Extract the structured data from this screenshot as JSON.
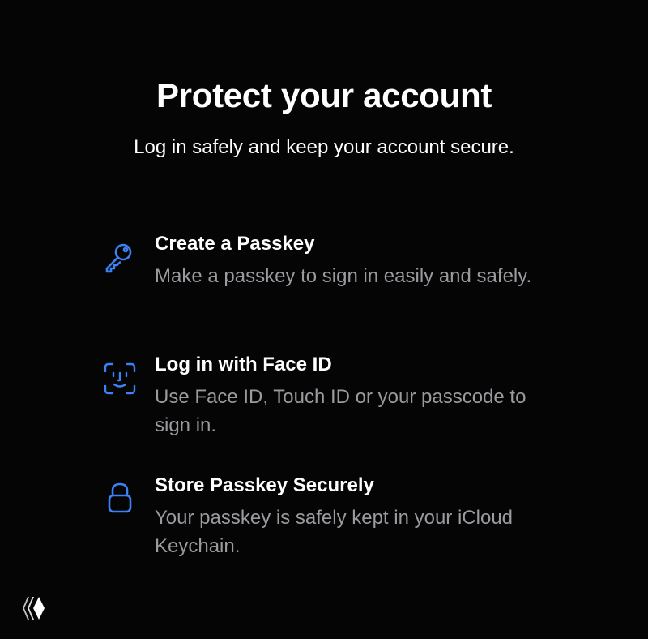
{
  "page": {
    "title": "Protect your account",
    "subtitle": "Log in safely and keep your account secure."
  },
  "features": [
    {
      "icon": "key-icon",
      "title": "Create a Passkey",
      "description": "Make a passkey to sign in easily and safely."
    },
    {
      "icon": "face-id-icon",
      "title": "Log in with Face ID",
      "description": "Use Face ID, Touch ID or your passcode to sign in."
    },
    {
      "icon": "lock-icon",
      "title": "Store Passkey Securely",
      "description": "Your passkey is safely kept in your iCloud Keychain."
    }
  ],
  "colors": {
    "background": "#050505",
    "text": "#ffffff",
    "secondary_text": "#9a9a9f",
    "accent": "#3b82f6"
  },
  "watermark": {
    "icon": "diamond-logo-icon"
  }
}
